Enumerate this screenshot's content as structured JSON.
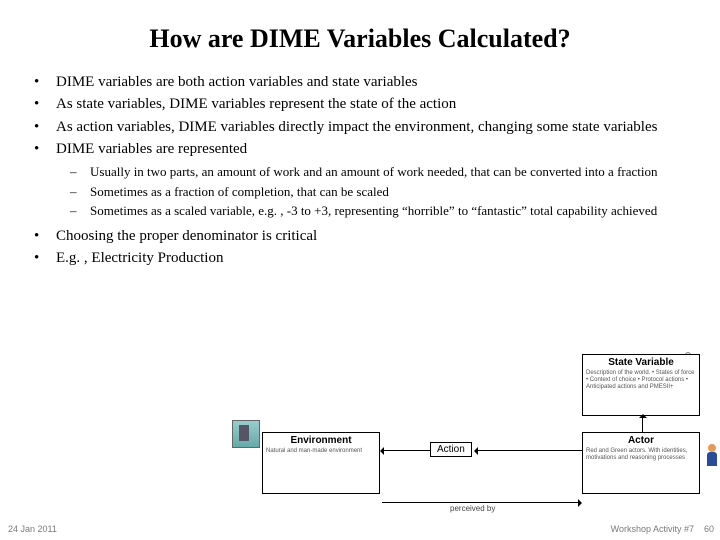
{
  "title": "How are DIME Variables Calculated?",
  "bullets": [
    "DIME variables are both action variables and state variables",
    "As state variables, DIME variables represent the state of the action",
    "As action variables, DIME variables directly impact the environment, changing some state variables",
    "DIME variables are represented"
  ],
  "sub_bullets": [
    "Usually in two parts, an amount of work and an amount of work needed, that can be converted into a fraction",
    "Sometimes as a fraction of completion, that can be scaled",
    "Sometimes as a scaled variable, e.g. , -3 to +3, representing “horrible” to “fantastic” total capability achieved"
  ],
  "bullets2": [
    "Choosing the proper denominator is critical",
    "E.g. , Electricity Production"
  ],
  "diagram": {
    "env_title": "Environment",
    "env_text": "Natural and man-made environment",
    "action_label": "Action",
    "perceived_label": "perceived by",
    "actor_title": "Actor",
    "actor_text": "Red and Green actors. With identities, motivations and reasoning processes",
    "sv_title": "State Variable",
    "sv_text": "Description of the world. • States of force • Context of choice • Protocol actions • Anticipated actions and PMESII+"
  },
  "footer": {
    "date": "24 Jan 2011",
    "right": "Workshop Activity #7",
    "page": "60"
  }
}
